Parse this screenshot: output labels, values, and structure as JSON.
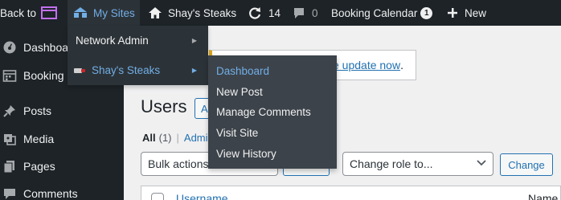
{
  "adminbar": {
    "back_label": "Back to",
    "my_sites_label": "My Sites",
    "site_name": "Shay's Steaks",
    "updates_count": "14",
    "comments_count": "0",
    "booking_label": "Booking Calendar",
    "booking_badge": "1",
    "new_label": "New"
  },
  "sidebar": {
    "items": [
      {
        "label": "Dashboa",
        "icon": "dashboard-icon"
      },
      {
        "label": "Booking",
        "icon": "calendar-icon"
      },
      {
        "label": "Posts",
        "icon": "pin-icon"
      },
      {
        "label": "Media",
        "icon": "media-icon"
      },
      {
        "label": "Pages",
        "icon": "pages-icon"
      },
      {
        "label": "Comments",
        "icon": "comment-icon"
      }
    ]
  },
  "notice": {
    "link_text": "e update now",
    "suffix": "."
  },
  "page": {
    "title": "Users",
    "add_label": "A",
    "filter_all": "All",
    "filter_all_count": "(1)",
    "filter_sep": "|",
    "filter_admin": "Admi",
    "bulk_actions": "Bulk actions",
    "change_role": "Change role to...",
    "change_label": "Change",
    "col_username": "Username",
    "col_name": "Name"
  },
  "my_sites_menu": {
    "network_admin": "Network Admin",
    "site_name": "Shay's Steaks"
  },
  "site_submenu": {
    "items": [
      "Dashboard",
      "New Post",
      "Manage Comments",
      "Visit Site",
      "View History"
    ]
  },
  "colors": {
    "adminbar_bg": "#1d2327",
    "menu_bg": "#2c3338",
    "submenu_bg": "#3c434a",
    "accent": "#72aee6",
    "link": "#2271b1"
  }
}
